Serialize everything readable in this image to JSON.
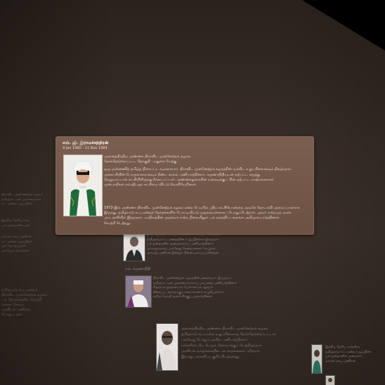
{
  "popup": {
    "name": "எம். ஜி. இராமச்சந்திரன்",
    "dates": "9 Jan 1980 - 11 Nov 1984",
    "paragraphs": [
      [
        "அனைத்திந்திய அண்ணா திராவிட முன்னேற்றக் கழகம்",
        "தேர்ந்தெடுக்கப்பட்ட தொகுதி : மதுரை மேற்கு"
      ],
      [
        "ஒரு முன்னணித் தமிழ்த் திரைப்பட நடிகராவார். திராவிட முன்னேற்றக் கழகத்தின் முக்கிய உறுப்பினராகவும் திகழ்ந்தார்.",
        "அக்கட்சியின் பொருளாளராகவும் நீண்ட காலம் பணியாற்றினார். கருணாநிதியுடன் ஏற்பட்ட கருத்து",
        "வேறுபாட்டால் கட்சியிலிருந்து நீக்கப்பட்டார். அண்ணாதுரையின் மறைவுக்குப் பின் ஏற்பட்ட மாற்றங்களால்",
        "முன்பாதிகள் எம்.ஜி.ஆர் கட்சியை விட்டு வெளியேறினார்."
      ],
      [
        "1972-இல் அண்ணா திராவிட முன்னேற்றக் கழகம் என்ற பெயரில் புதிய கட்சியொன்றை அவரே தொடங்கி அமைப்பாளராக",
        "இருந்து, தமிழ்நாடு சட்டமன்றத் தேர்தல்களில் போட்டியிட்டு முதலமைச்சராகப் பொறுப்பேற்றார். அவர் மறையும் வரை",
        "அப்பதவியில் இருந்தார். மாநிலத்தின் முதல்வர் என்ற நிலையிலும் பல நலத்திட்டங்களை அறிமுகப்படுத்தினார்.",
        "வெற்றி பெற்றது."
      ]
    ]
  },
  "background_entries": [
    {
      "name": "",
      "lines": [
        "இவர் இந்திய தேசிய காங்கிரசு கட்சியைச் சேர்ந்தவர்",
        "தமிழ்நாடு சட்டமன்றத்தின் உறுப்பினராக இருந்தார்",
        "பல துறைகளில் அமைச்சராகப் பணியாற்றினார்",
        "மக்களுக்காகப் பல்வேறு சேவைகளைச் செய்தார்",
        "அவரது பணிகள் இன்றும் நினைவுகூரப்படுகின்றன"
      ]
    },
    {
      "name": "எம். கருணாநிதி",
      "lines": [
        "திராவிட முன்னேற்றக் கழகத்தின் தலைவராக இருந்தார்",
        "தமிழ்நாட்டின் முதலமைச்சராகப் பலமுறை பணியாற்றினார்",
        "சிறந்த எழுத்தாளரும் பேச்சாளரும் ஆவார்",
        "திரைப்படங்களுக்குக் கதை வசனம் எழுதியுள்ளார்",
        "தமிழ் மொழி வளர்ச்சிக்குப் பங்காற்றினார்"
      ]
    },
    {
      "name": "",
      "lines": [
        "அனைத்திந்திய அண்ணா திராவிட முன்னேற்றக் கழகம்",
        "தமிழ்நாடு சட்டமன்ற உறுப்பினராகத் தேர்ந்தெடுக்கப்பட்டார்",
        "பல்வேறு பொறுப்புகளில் பணியாற்றினார்",
        "மக்களிடையே பெரும் செல்வாக்குப் பெற்றிருந்தார்",
        "அரசியல் வாழ்க்கையில் பல சாதனைகள் புரிந்தார்",
        "இவரது பங்களிப்பு குறிப்பிடத்தக்கது"
      ]
    },
    {
      "name": "",
      "lines": [
        "இந்திய தேசிய காங்கிரசு",
        "தமிழ்நாடு சட்டமன்ற உறுப்பினர்",
        "பல துறைகளில் அமைச்சர்",
        "மக்கள் நலப் பணிகள்"
      ]
    }
  ],
  "left_texts": [
    [
      "திராவிட முன்னேற்றக் கழகம்",
      "தமிழ்நாட்டின் முதலமைச்சர்",
      "சட்டமன்ற உறுப்பினர்"
    ],
    [
      "இந்திய தேசிய காங்கிரசு",
      "பல துறைகளில் அமைச்சர்"
    ],
    [
      "மக்கள் நலப் பணிகள்",
      "சட்டமன்ற உறுப்பினர்",
      "பல பொறுப்புகள்",
      "அரசியல் வாழ்க்கை"
    ],
    [
      "தமிழ்நாடு சட்டமன்றம்",
      "திராவிட முன்னேற்றக் கழகம்",
      "பல தேர்தல்களில் வெற்றி",
      "மக்கள் சேவை",
      "அரசியல் பணிகள்",
      "பொறுப்புகள்"
    ]
  ],
  "colors": {
    "wall": "#3a2f28",
    "card": "#7a5e4f",
    "corner": "#000000"
  }
}
